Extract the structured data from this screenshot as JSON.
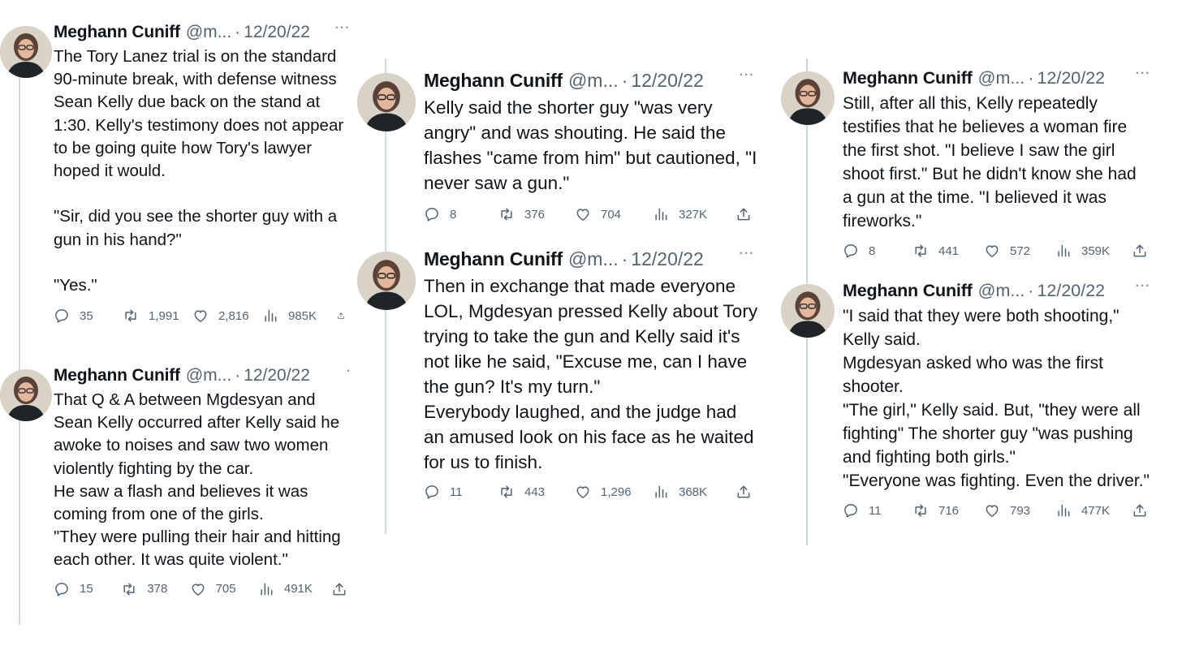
{
  "author": {
    "name": "Meghann Cuniff",
    "handle": "@m...",
    "date": "12/20/22"
  },
  "tweets": [
    {
      "text": "The Tory Lanez trial is on the standard 90-minute break, with defense witness Sean Kelly due back on the stand at 1:30. Kelly's testimony does not appear to be going quite how Tory's lawyer hoped it would.\n\n\"Sir, did you see the shorter guy with a gun in his hand?\"\n\n\"Yes.\"",
      "replies": "35",
      "retweets": "1,991",
      "likes": "2,816",
      "views": "985K"
    },
    {
      "text": "That Q & A between Mgdesyan and Sean Kelly occurred after Kelly said he awoke to noises and saw two women violently fighting by the car.\nHe saw a flash and believes it was coming from one of the girls.\n\"They were pulling their hair and hitting each other. It was quite violent.\"",
      "replies": "15",
      "retweets": "378",
      "likes": "705",
      "views": "491K"
    },
    {
      "text": "Kelly said the shorter guy \"was very angry\" and was shouting. He said the flashes \"came from him\" but cautioned, \"I never saw a gun.\"",
      "replies": "8",
      "retweets": "376",
      "likes": "704",
      "views": "327K"
    },
    {
      "text": "Then in exchange that made everyone LOL, Mgdesyan pressed Kelly about Tory trying to take the gun and Kelly said it's not like he said, \"Excuse me, can I have the gun? It's my turn.\"\nEverybody laughed, and the judge had an amused look on his face as he waited for us to finish.",
      "replies": "11",
      "retweets": "443",
      "likes": "1,296",
      "views": "368K"
    },
    {
      "text": "Still, after all this, Kelly repeatedly testifies that he believes a woman fire the first shot. \"I believe I saw the girl shoot first.\" But he didn't know she had a gun at the time. \"I believed it was fireworks.\"",
      "replies": "8",
      "retweets": "441",
      "likes": "572",
      "views": "359K"
    },
    {
      "text": "\"I said that they were both shooting,\" Kelly said.\nMgdesyan asked who was the first shooter.\n\"The girl,\" Kelly said. But, \"they were all fighting\" The shorter guy \"was pushing and fighting both girls.\"\n\"Everyone was fighting. Even the driver.\"",
      "replies": "11",
      "retweets": "716",
      "likes": "793",
      "views": "477K"
    }
  ],
  "icons": [
    "reply-icon",
    "retweet-icon",
    "like-icon",
    "views-icon",
    "share-icon",
    "more-icon"
  ]
}
